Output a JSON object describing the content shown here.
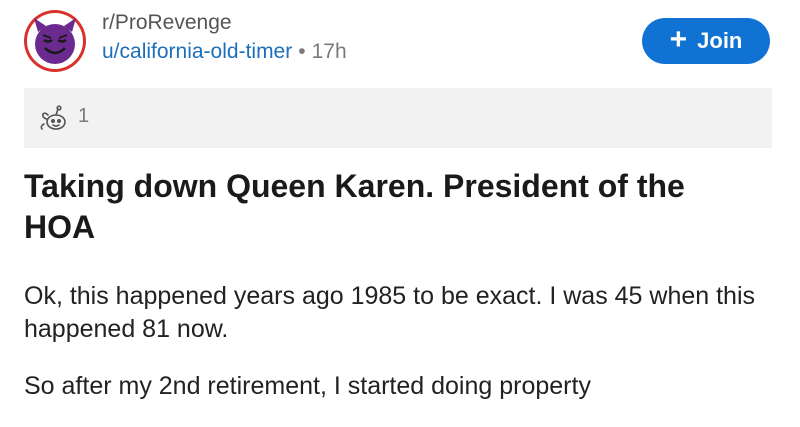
{
  "post": {
    "subreddit": "r/ProRevenge",
    "username": "u/california-old-timer",
    "separator": "•",
    "age": "17h",
    "join_label": "Join",
    "join_icon": "plus-icon",
    "award_icon": "award-icon",
    "award_count": "1",
    "title": "Taking down Queen Karen. President of the HOA",
    "paragraphs": [
      "Ok, this happened years ago 1985 to be exact. I was 45 when this happened 81 now.",
      "So after my 2nd retirement, I started doing property"
    ]
  },
  "colors": {
    "accent": "#1073d3",
    "username": "#1d6fb8",
    "avatar_bg": "#6b2a8f",
    "avatar_ring": "#d9312b"
  }
}
